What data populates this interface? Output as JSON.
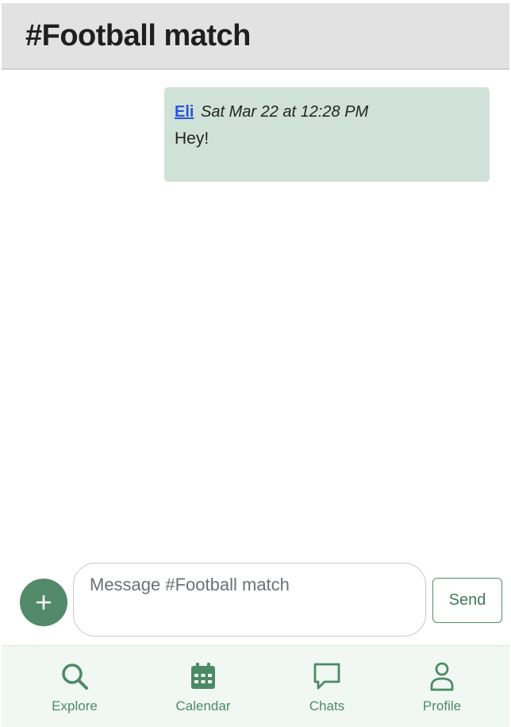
{
  "header": {
    "title": "#Football match"
  },
  "messages": [
    {
      "author": "Eli",
      "timestamp": "Sat Mar 22 at 12:28 PM",
      "text": "Hey!"
    }
  ],
  "composer": {
    "placeholder": "Message #Football match",
    "add_icon": "plus-icon",
    "send_label": "Send"
  },
  "nav": {
    "items": [
      {
        "label": "Explore",
        "icon": "search-icon"
      },
      {
        "label": "Calendar",
        "icon": "calendar-icon"
      },
      {
        "label": "Chats",
        "icon": "chat-bubble-icon"
      },
      {
        "label": "Profile",
        "icon": "person-icon"
      }
    ]
  },
  "colors": {
    "accent": "#538a69",
    "message_bg": "#d0e2d7",
    "header_bg": "#e2e2e2",
    "nav_bg": "#f1f7f3",
    "link": "#2a55d8"
  }
}
